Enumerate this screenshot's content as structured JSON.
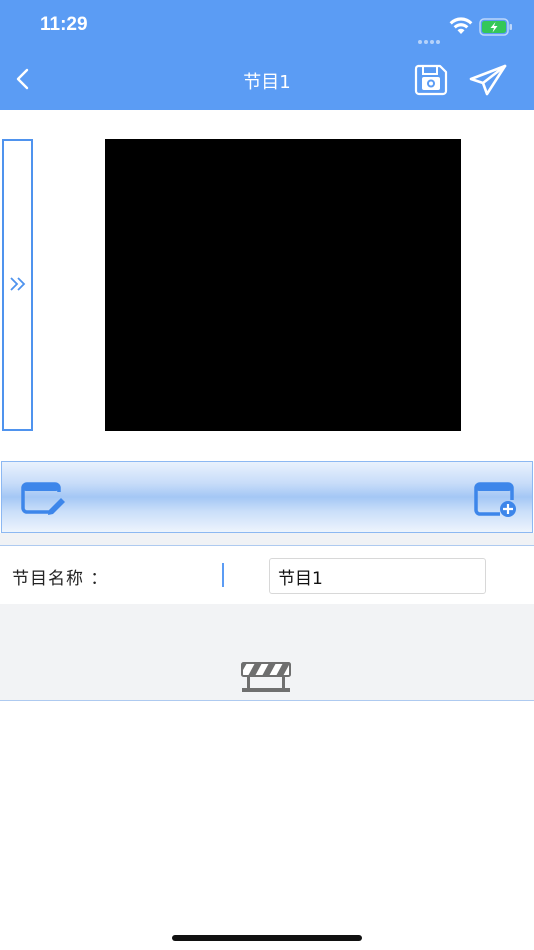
{
  "status_bar": {
    "time": "11:29",
    "icons": [
      "signal-dots-icon",
      "wifi-icon",
      "battery-charging-icon"
    ],
    "battery_color": "#34c759"
  },
  "nav": {
    "title": "节目1",
    "back_icon": "chevron-left-icon",
    "save_icon": "floppy-disk-icon",
    "send_icon": "paper-plane-icon",
    "color": "#5b9cf4"
  },
  "side_panel": {
    "icon": "double-chevron-right-icon"
  },
  "preview": {
    "background": "#000000"
  },
  "toolbar": {
    "edit_icon": "edit-window-icon",
    "add_icon": "add-window-icon"
  },
  "program_name": {
    "label": "节目名称 ：",
    "value": "节目1"
  },
  "empty_area": {
    "icon": "barrier-icon"
  }
}
